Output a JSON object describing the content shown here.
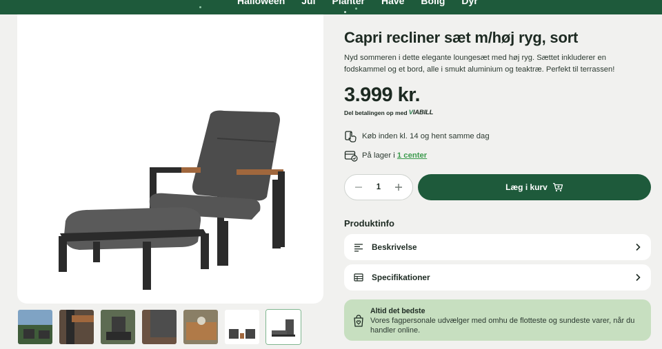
{
  "nav": {
    "items": [
      "Halloween",
      "Jul",
      "Planter",
      "Have",
      "Bolig",
      "Dyr"
    ]
  },
  "product": {
    "title": "Capri recliner sæt m/høj ryg, sort",
    "description": "Nyd sommeren i dette elegante loungesæt med høj ryg. Sættet inkluderer en fodskammel og et bord, alle i smukt aluminium og teaktræ. Perfekt til terrassen!",
    "price": "3.999 kr.",
    "viabill_prefix": "Del betalingen op med",
    "viabill_brand_v": "V",
    "viabill_brand_rest": "IABILL"
  },
  "delivery": {
    "pickup_text": "Køb inden kl. 14 og hent samme dag",
    "stock_prefix": "På lager i ",
    "stock_link": "1 center"
  },
  "cart": {
    "quantity": "1",
    "add_label": "Læg i kurv"
  },
  "product_info": {
    "heading": "Produktinfo",
    "items": [
      {
        "label": "Beskrivelse",
        "icon": "text-lines-icon"
      },
      {
        "label": "Specifikationer",
        "icon": "table-icon"
      }
    ]
  },
  "promo": {
    "title": "Altid det bedste",
    "body": "Vores fagpersonale udvælger med omhu de flotteste og sundeste varer, når du handler online.",
    "icon": "heart-bag-icon"
  },
  "thumbnails": {
    "count": 7,
    "active_index": 6
  },
  "colors": {
    "brand_green": "#1e5a3b",
    "promo_bg": "#c7dfc0",
    "link_green": "#3b9a4c",
    "page_bg": "#f1f1ef"
  }
}
